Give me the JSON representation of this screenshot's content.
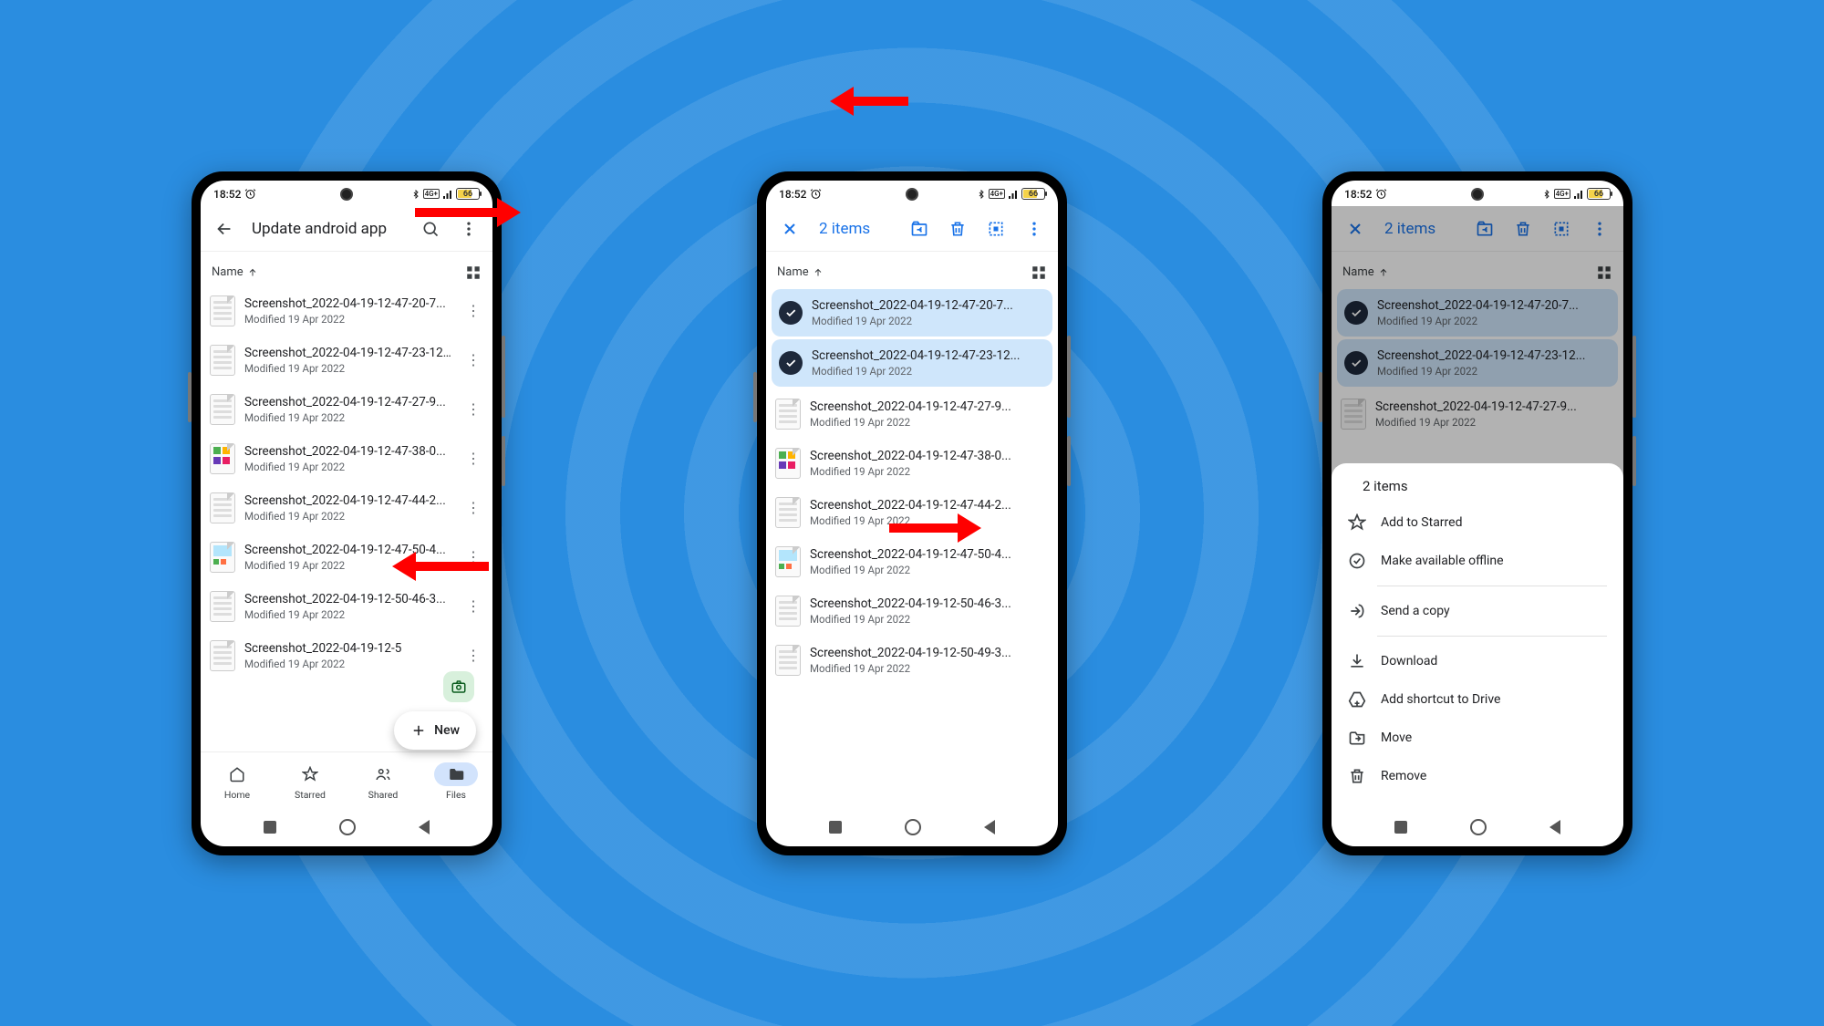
{
  "status": {
    "time": "18:52",
    "battery": "66"
  },
  "sort": {
    "label": "Name"
  },
  "phone1": {
    "appbar": {
      "title": "Update android app"
    },
    "fab": "New",
    "nav": {
      "home": "Home",
      "starred": "Starred",
      "shared": "Shared",
      "files": "Files"
    },
    "files": [
      {
        "name": "Screenshot_2022-04-19-12-47-20-7...",
        "mod": "Modified 19 Apr 2022",
        "thumb": "bars"
      },
      {
        "name": "Screenshot_2022-04-19-12-47-23-12...",
        "mod": "Modified 19 Apr 2022",
        "thumb": "bars"
      },
      {
        "name": "Screenshot_2022-04-19-12-47-27-9...",
        "mod": "Modified 19 Apr 2022",
        "thumb": "bars"
      },
      {
        "name": "Screenshot_2022-04-19-12-47-38-0...",
        "mod": "Modified 19 Apr 2022",
        "thumb": "color"
      },
      {
        "name": "Screenshot_2022-04-19-12-47-44-2...",
        "mod": "Modified 19 Apr 2022",
        "thumb": "bars"
      },
      {
        "name": "Screenshot_2022-04-19-12-47-50-4...",
        "mod": "Modified 19 Apr 2022",
        "thumb": "home"
      },
      {
        "name": "Screenshot_2022-04-19-12-50-46-3...",
        "mod": "Modified 19 Apr 2022",
        "thumb": "bars"
      },
      {
        "name": "Screenshot_2022-04-19-12-5",
        "mod": "Modified 19 Apr 2022",
        "thumb": "bars"
      }
    ]
  },
  "phone2": {
    "appbar": {
      "title": "2 items"
    },
    "files": [
      {
        "name": "Screenshot_2022-04-19-12-47-20-7...",
        "mod": "Modified 19 Apr 2022",
        "selected": true
      },
      {
        "name": "Screenshot_2022-04-19-12-47-23-12...",
        "mod": "Modified 19 Apr 2022",
        "selected": true
      },
      {
        "name": "Screenshot_2022-04-19-12-47-27-9...",
        "mod": "Modified 19 Apr 2022",
        "thumb": "bars"
      },
      {
        "name": "Screenshot_2022-04-19-12-47-38-0...",
        "mod": "Modified 19 Apr 2022",
        "thumb": "color"
      },
      {
        "name": "Screenshot_2022-04-19-12-47-44-2...",
        "mod": "Modified 19 Apr 2022",
        "thumb": "bars"
      },
      {
        "name": "Screenshot_2022-04-19-12-47-50-4...",
        "mod": "Modified 19 Apr 2022",
        "thumb": "home"
      },
      {
        "name": "Screenshot_2022-04-19-12-50-46-3...",
        "mod": "Modified 19 Apr 2022",
        "thumb": "bars"
      },
      {
        "name": "Screenshot_2022-04-19-12-50-49-3...",
        "mod": "Modified 19 Apr 2022",
        "thumb": "bars"
      }
    ]
  },
  "phone3": {
    "appbar": {
      "title": "2 items"
    },
    "files": [
      {
        "name": "Screenshot_2022-04-19-12-47-20-7...",
        "mod": "Modified 19 Apr 2022",
        "selected": true
      },
      {
        "name": "Screenshot_2022-04-19-12-47-23-12...",
        "mod": "Modified 19 Apr 2022",
        "selected": true
      },
      {
        "name": "Screenshot_2022-04-19-12-47-27-9...",
        "mod": "Modified 19 Apr 2022",
        "thumb": "bars"
      }
    ],
    "sheet": {
      "title": "2 items",
      "items": {
        "star": "Add to Starred",
        "offline": "Make available offline",
        "send": "Send a copy",
        "download": "Download",
        "shortcut": "Add shortcut to Drive",
        "move": "Move",
        "remove": "Remove"
      }
    }
  }
}
